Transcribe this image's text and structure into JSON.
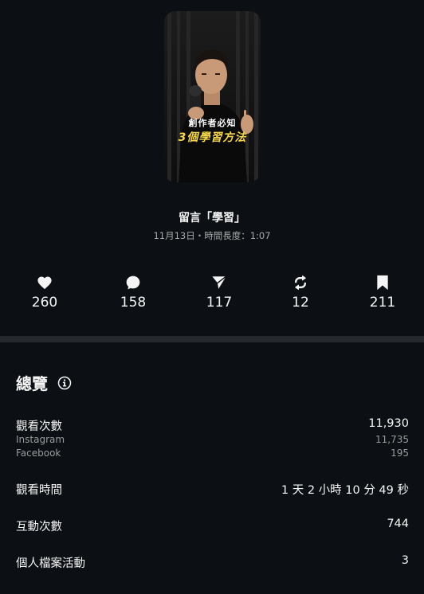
{
  "post": {
    "thumbnail_caption_line1": "創作者必知",
    "thumbnail_caption_line2": "3個學習方法",
    "title": "留言「學習」",
    "meta": "11月13日・時間長度：1:07"
  },
  "stats": {
    "likes": "260",
    "comments": "158",
    "shares": "117",
    "reposts": "12",
    "saves": "211"
  },
  "overview": {
    "title": "總覽",
    "views_label": "觀看次數",
    "views_value": "11,930",
    "instagram_label": "Instagram",
    "instagram_value": "11,735",
    "facebook_label": "Facebook",
    "facebook_value": "195",
    "watch_time_label": "觀看時間",
    "watch_time_value": "1 天 2 小時 10 分 49 秒",
    "interactions_label": "互動次數",
    "interactions_value": "744",
    "profile_activity_label": "個人檔案活動",
    "profile_activity_value": "3"
  },
  "colors": {
    "background": "#0c1014",
    "divider": "#262a2f",
    "caption_accent": "#f7d84a"
  }
}
